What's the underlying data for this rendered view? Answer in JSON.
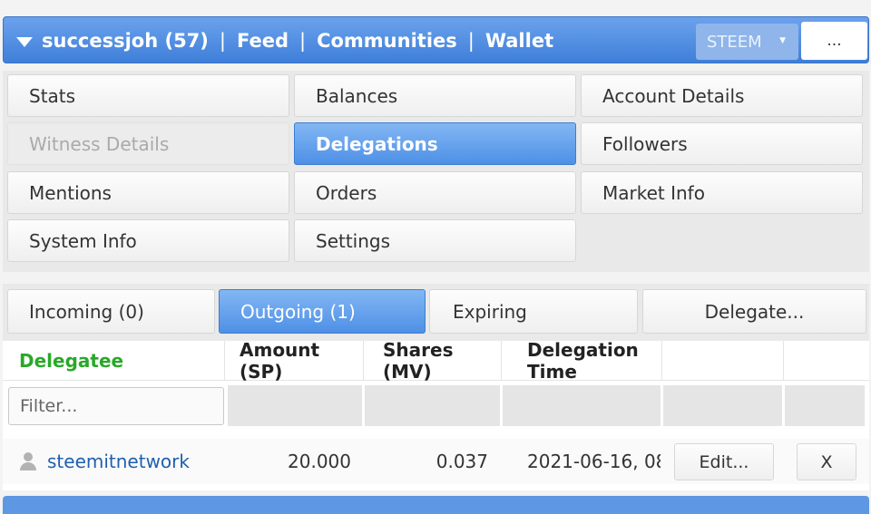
{
  "header": {
    "user": "successjoh (57)",
    "links": [
      "Feed",
      "Communities",
      "Wallet"
    ],
    "separator": "|",
    "chain_select": "STEEM",
    "more_label": "..."
  },
  "menu": {
    "stats": "Stats",
    "balances": "Balances",
    "account_details": "Account Details",
    "witness_details": "Witness Details",
    "delegations": "Delegations",
    "followers": "Followers",
    "mentions": "Mentions",
    "orders": "Orders",
    "market_info": "Market Info",
    "system_info": "System Info",
    "settings": "Settings"
  },
  "tabs": {
    "incoming": "Incoming (0)",
    "outgoing": "Outgoing (1)",
    "expiring": "Expiring",
    "delegate": "Delegate..."
  },
  "table": {
    "columns": [
      "Delegatee",
      "Amount (SP)",
      "Shares (MV)",
      "Delegation Time"
    ],
    "filter_placeholder": "Filter...",
    "rows": [
      {
        "delegatee": "steemitnetwork",
        "amount": "20.000",
        "shares": "0.037",
        "time": "2021-06-16, 08:",
        "edit_label": "Edit...",
        "remove_label": "X"
      }
    ]
  },
  "colors": {
    "accent": "#4e90e6",
    "header": "#3f7fd9",
    "delegatee_header": "#29a829",
    "link": "#1f5fae"
  }
}
